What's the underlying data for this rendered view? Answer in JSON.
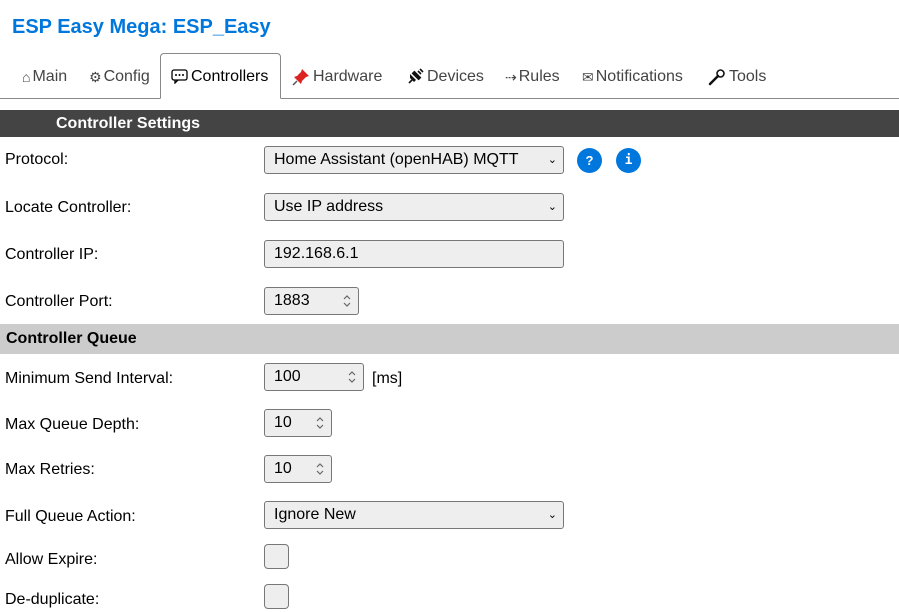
{
  "header": {
    "title": "ESP Easy Mega: ESP_Easy"
  },
  "tabs": [
    {
      "label": "Main",
      "icon": "home-icon"
    },
    {
      "label": "Config",
      "icon": "gear-icon"
    },
    {
      "label": "Controllers",
      "icon": "speech-bubble-icon",
      "active": true
    },
    {
      "label": "Hardware",
      "icon": "pushpin-icon"
    },
    {
      "label": "Devices",
      "icon": "plug-icon"
    },
    {
      "label": "Rules",
      "icon": "arrow-icon"
    },
    {
      "label": "Notifications",
      "icon": "envelope-icon"
    },
    {
      "label": "Tools",
      "icon": "wrench-icon"
    }
  ],
  "sections": {
    "controller_settings": "Controller Settings",
    "controller_queue": "Controller Queue"
  },
  "fields": {
    "protocol": {
      "label": "Protocol:",
      "value": "Home Assistant (openHAB) MQTT"
    },
    "help": {
      "question": "?",
      "info": "i"
    },
    "locate": {
      "label": "Locate Controller:",
      "value": "Use IP address"
    },
    "ip": {
      "label": "Controller IP:",
      "value": "192.168.6.1"
    },
    "port": {
      "label": "Controller Port:",
      "value": "1883"
    },
    "min_send": {
      "label": "Minimum Send Interval:",
      "value": "100",
      "unit": "[ms]"
    },
    "max_queue": {
      "label": "Max Queue Depth:",
      "value": "10"
    },
    "max_retries": {
      "label": "Max Retries:",
      "value": "10"
    },
    "full_queue": {
      "label": "Full Queue Action:",
      "value": "Ignore New"
    },
    "allow_expire": {
      "label": "Allow Expire:",
      "checked": false
    },
    "dedup": {
      "label": "De-duplicate:",
      "checked": false
    }
  },
  "colors": {
    "accent": "#0077DD",
    "section_dark": "#444444",
    "section_light": "#CCCCCC"
  }
}
